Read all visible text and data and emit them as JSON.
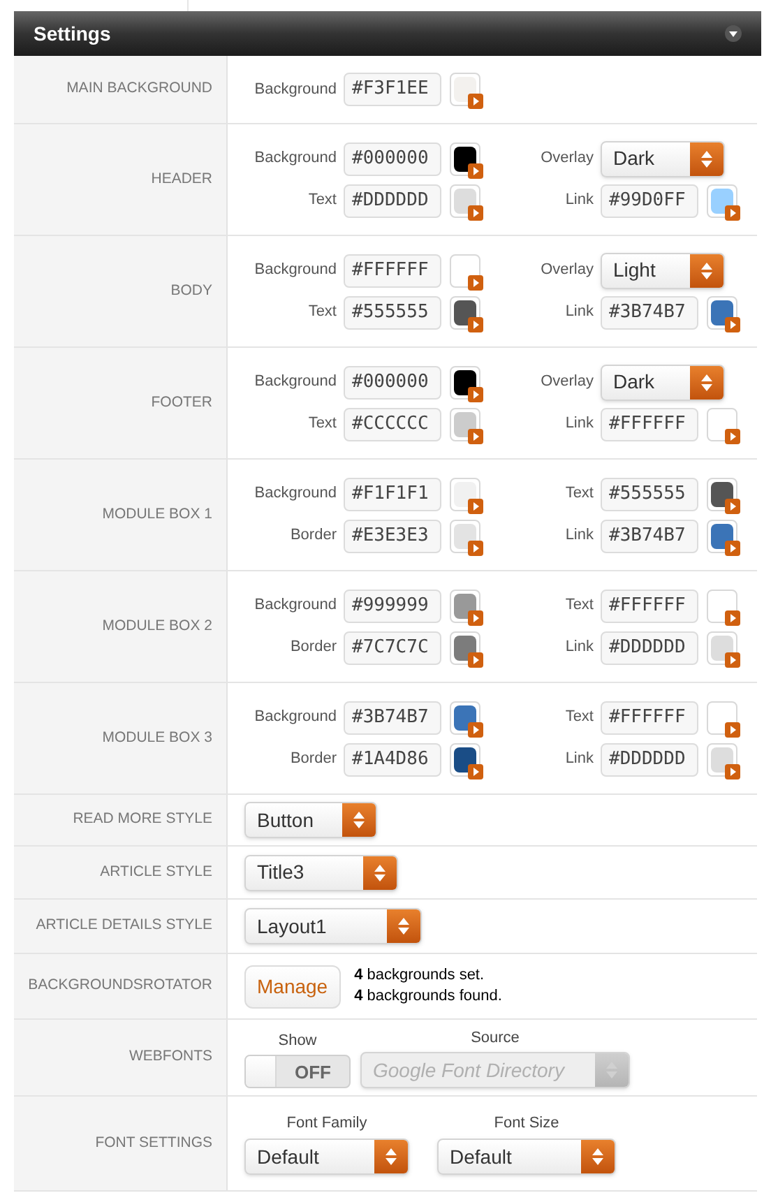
{
  "panel": {
    "title": "Settings"
  },
  "sections": [
    {
      "kind": "colors",
      "label": "MAIN BACKGROUND",
      "left": [
        {
          "kind": "color",
          "label": "Background",
          "value": "#F3F1EE",
          "color": "#f3f1ee"
        }
      ]
    },
    {
      "kind": "colors",
      "label": "HEADER",
      "left": [
        {
          "kind": "color",
          "label": "Background",
          "value": "#000000",
          "color": "#000000"
        },
        {
          "kind": "color",
          "label": "Text",
          "value": "#DDDDDD",
          "color": "#dddddd"
        }
      ],
      "right": [
        {
          "kind": "select",
          "label": "Overlay",
          "value": "Dark"
        },
        {
          "kind": "color",
          "label": "Link",
          "value": "#99D0FF",
          "color": "#99d0ff"
        }
      ]
    },
    {
      "kind": "colors",
      "label": "BODY",
      "left": [
        {
          "kind": "color",
          "label": "Background",
          "value": "#FFFFFF",
          "color": "#ffffff"
        },
        {
          "kind": "color",
          "label": "Text",
          "value": "#555555",
          "color": "#555555"
        }
      ],
      "right": [
        {
          "kind": "select",
          "label": "Overlay",
          "value": "Light"
        },
        {
          "kind": "color",
          "label": "Link",
          "value": "#3B74B7",
          "color": "#3b74b7"
        }
      ]
    },
    {
      "kind": "colors",
      "label": "FOOTER",
      "left": [
        {
          "kind": "color",
          "label": "Background",
          "value": "#000000",
          "color": "#000000"
        },
        {
          "kind": "color",
          "label": "Text",
          "value": "#CCCCCC",
          "color": "#cccccc"
        }
      ],
      "right": [
        {
          "kind": "select",
          "label": "Overlay",
          "value": "Dark"
        },
        {
          "kind": "color",
          "label": "Link",
          "value": "#FFFFFF",
          "color": "#ffffff"
        }
      ]
    },
    {
      "kind": "colors",
      "label": "MODULE BOX 1",
      "left": [
        {
          "kind": "color",
          "label": "Background",
          "value": "#F1F1F1",
          "color": "#f1f1f1"
        },
        {
          "kind": "color",
          "label": "Border",
          "value": "#E3E3E3",
          "color": "#e3e3e3"
        }
      ],
      "right": [
        {
          "kind": "color",
          "label": "Text",
          "value": "#555555",
          "color": "#555555"
        },
        {
          "kind": "color",
          "label": "Link",
          "value": "#3B74B7",
          "color": "#3b74b7"
        }
      ]
    },
    {
      "kind": "colors",
      "label": "MODULE BOX 2",
      "left": [
        {
          "kind": "color",
          "label": "Background",
          "value": "#999999",
          "color": "#999999"
        },
        {
          "kind": "color",
          "label": "Border",
          "value": "#7C7C7C",
          "color": "#7c7c7c"
        }
      ],
      "right": [
        {
          "kind": "color",
          "label": "Text",
          "value": "#FFFFFF",
          "color": "#ffffff"
        },
        {
          "kind": "color",
          "label": "Link",
          "value": "#DDDDDD",
          "color": "#dddddd"
        }
      ]
    },
    {
      "kind": "colors",
      "label": "MODULE BOX 3",
      "left": [
        {
          "kind": "color",
          "label": "Background",
          "value": "#3B74B7",
          "color": "#3b74b7"
        },
        {
          "kind": "color",
          "label": "Border",
          "value": "#1A4D86",
          "color": "#1a4d86"
        }
      ],
      "right": [
        {
          "kind": "color",
          "label": "Text",
          "value": "#FFFFFF",
          "color": "#ffffff"
        },
        {
          "kind": "color",
          "label": "Link",
          "value": "#DDDDDD",
          "color": "#dddddd"
        }
      ]
    },
    {
      "kind": "select",
      "label": "READ MORE STYLE",
      "value": "Button"
    },
    {
      "kind": "select",
      "label": "ARTICLE STYLE",
      "value": "Title3"
    },
    {
      "kind": "select",
      "label": "ARTICLE DETAILS STYLE",
      "value": "Layout1"
    },
    {
      "kind": "rotator",
      "label": "BACKGROUNDSROTATOR",
      "button": "Manage",
      "lines": [
        "**4** backgrounds set.",
        "**4** backgrounds found."
      ]
    },
    {
      "kind": "webfonts",
      "label": "WEBFONTS",
      "show_label": "Show",
      "toggle": {
        "text": "OFF",
        "on": false
      },
      "source_label": "Source",
      "source": {
        "value": "Google Font Directory",
        "disabled": true
      }
    },
    {
      "kind": "fonts",
      "label": "FONT SETTINGS",
      "fields": [
        {
          "label": "Font Family",
          "value": "Default"
        },
        {
          "label": "Font Size",
          "value": "Default"
        }
      ]
    }
  ]
}
